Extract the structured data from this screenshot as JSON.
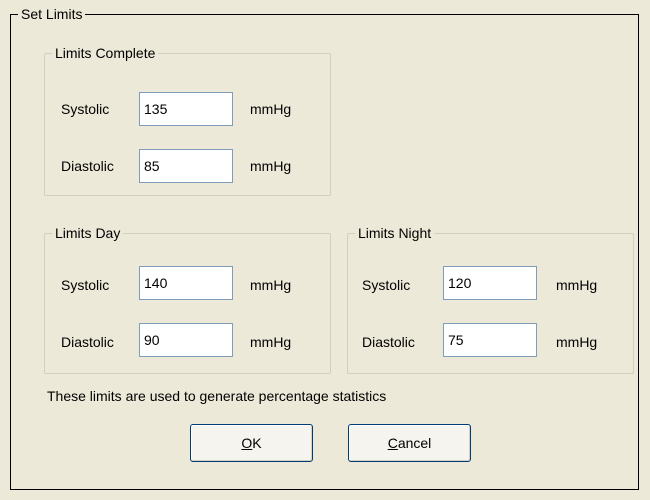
{
  "dialog": {
    "outer_group_title": "Set Limits",
    "note": "These limits are used to generate percentage statistics"
  },
  "complete": {
    "title": "Limits Complete",
    "systolic_label": "Systolic",
    "systolic_value": "135",
    "diastolic_label": "Diastolic",
    "diastolic_value": "85",
    "unit": "mmHg"
  },
  "day": {
    "title": "Limits Day",
    "systolic_label": "Systolic",
    "systolic_value": "140",
    "diastolic_label": "Diastolic",
    "diastolic_value": "90",
    "unit": "mmHg"
  },
  "night": {
    "title": "Limits Night",
    "systolic_label": "Systolic",
    "systolic_value": "120",
    "diastolic_label": "Diastolic",
    "diastolic_value": "75",
    "unit": "mmHg"
  },
  "buttons": {
    "ok_mnemonic": "O",
    "ok_rest": "K",
    "cancel_mnemonic": "C",
    "cancel_rest": "ancel"
  }
}
